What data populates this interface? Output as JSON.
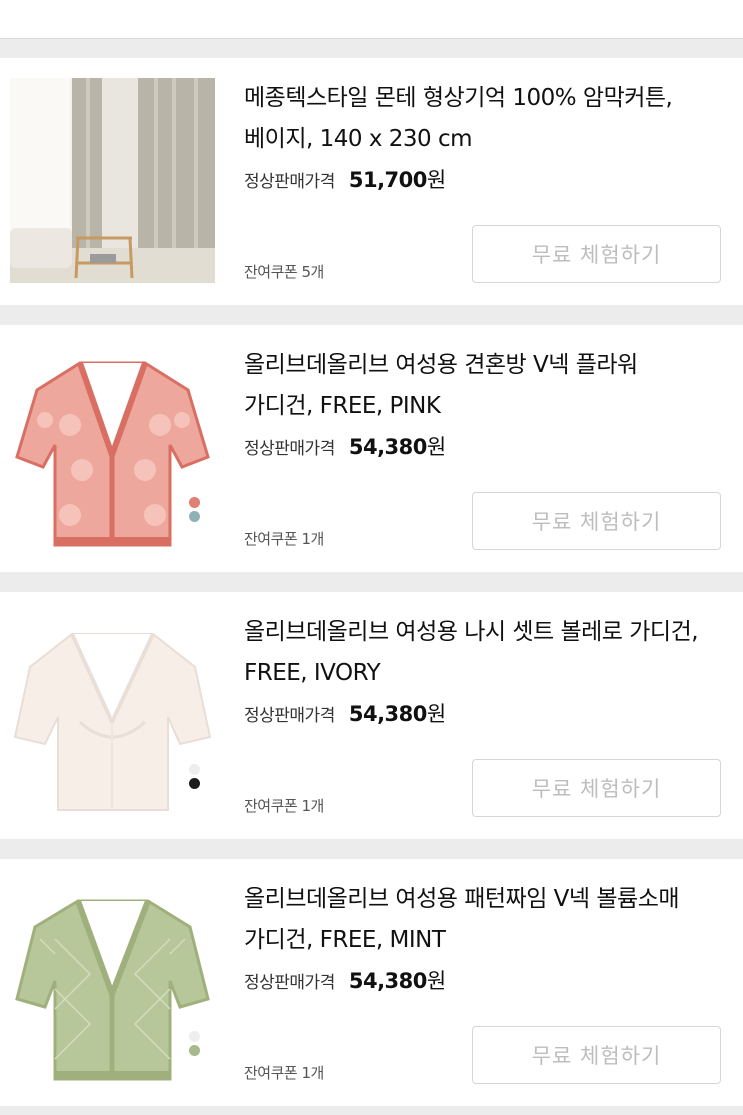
{
  "common": {
    "price_label": "정상판매가격",
    "won": "원",
    "trial_button": "무료 체험하기"
  },
  "products": [
    {
      "title_line1": "메종텍스타일 몬테 형상기억 100% 암막커튼,",
      "title_line2": "베이지, 140 x 230 cm",
      "price": "51,700",
      "coupon": "잔여쿠폰 5개",
      "image": "beige-blackout-curtain"
    },
    {
      "title_line1": "올리브데올리브 여성용 견혼방 V넥 플라워",
      "title_line2": "가디건, FREE, PINK",
      "price": "54,380",
      "coupon": "잔여쿠폰 1개",
      "image": "pink-flower-cardigan",
      "swatches": [
        "#e07f73",
        "#8fb0b4"
      ]
    },
    {
      "title_line1": "올리브데올리브 여성용 나시 셋트 볼레로 가디건,",
      "title_line2": "FREE, IVORY",
      "price": "54,380",
      "coupon": "잔여쿠폰 1개",
      "image": "ivory-bolero-cardigan",
      "swatches": [
        "#eeeeee",
        "#1c1c1c"
      ]
    },
    {
      "title_line1": "올리브데올리브 여성용 패턴짜임 V넥 볼륨소매",
      "title_line2": "가디건, FREE, MINT",
      "price": "54,380",
      "coupon": "잔여쿠폰 1개",
      "image": "mint-pattern-cardigan",
      "swatches": [
        "#eeeeee",
        "#a9b88a"
      ]
    }
  ]
}
